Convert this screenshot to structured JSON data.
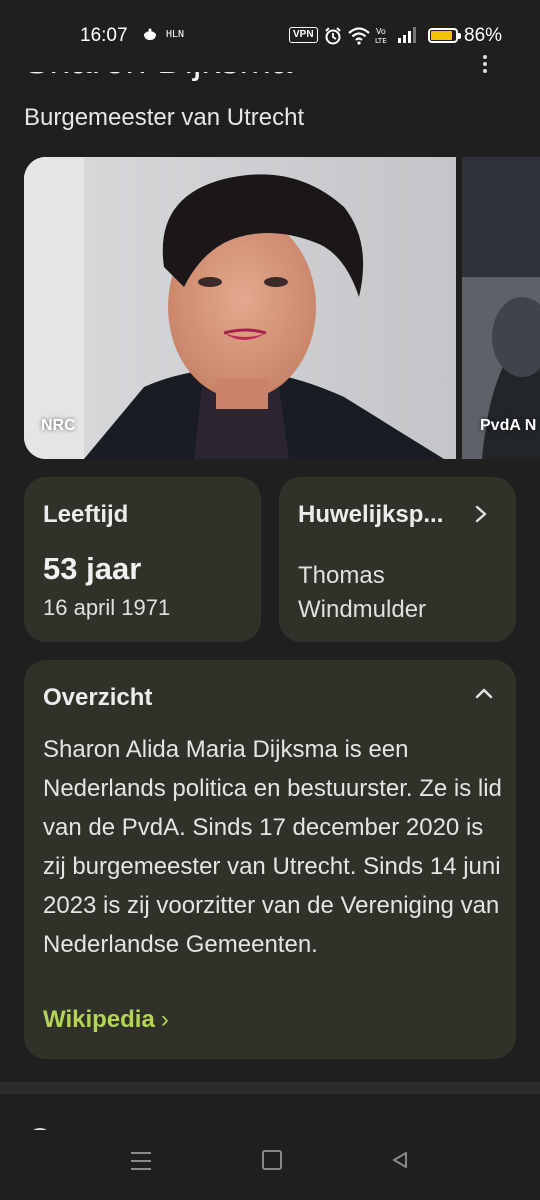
{
  "status_bar": {
    "time": "16:07",
    "app_label": "HLN",
    "vpn": "VPN",
    "battery_percent": "86%",
    "battery_level": 0.86,
    "battery_color": "#f2c300",
    "icons": [
      "notification-app-icon",
      "alarm-icon",
      "wifi-icon",
      "volte-icon",
      "signal-icon",
      "battery-icon"
    ]
  },
  "header": {
    "title": "Sharon Dijksma",
    "subtitle": "Burgemeester van Utrecht"
  },
  "images": [
    {
      "caption": "NRC"
    },
    {
      "caption": "PvdA N"
    }
  ],
  "cards": {
    "age": {
      "label": "Leeftijd",
      "value": "53 jaar",
      "sub": "16 april 1971"
    },
    "spouse": {
      "label": "Huwelijksp...",
      "name_line1": "Thomas",
      "name_line2": "Windmulder"
    }
  },
  "overview": {
    "title": "Overzicht",
    "text": "Sharon Alida Maria Dijksma is een Nederlands politica en bestuurster. Ze is lid van de PvdA. Sinds 17 december 2020 is zij burgemeester van Utrecht. Sinds 14 juni 2023 is zij voorzitter van de Vereniging van Nederlandse Gemeenten.",
    "link": "Wikipedia",
    "link_chevron": "›",
    "link_color": "#b4d455"
  },
  "colors": {
    "background": "#1f1f1f",
    "card": "#303129"
  }
}
